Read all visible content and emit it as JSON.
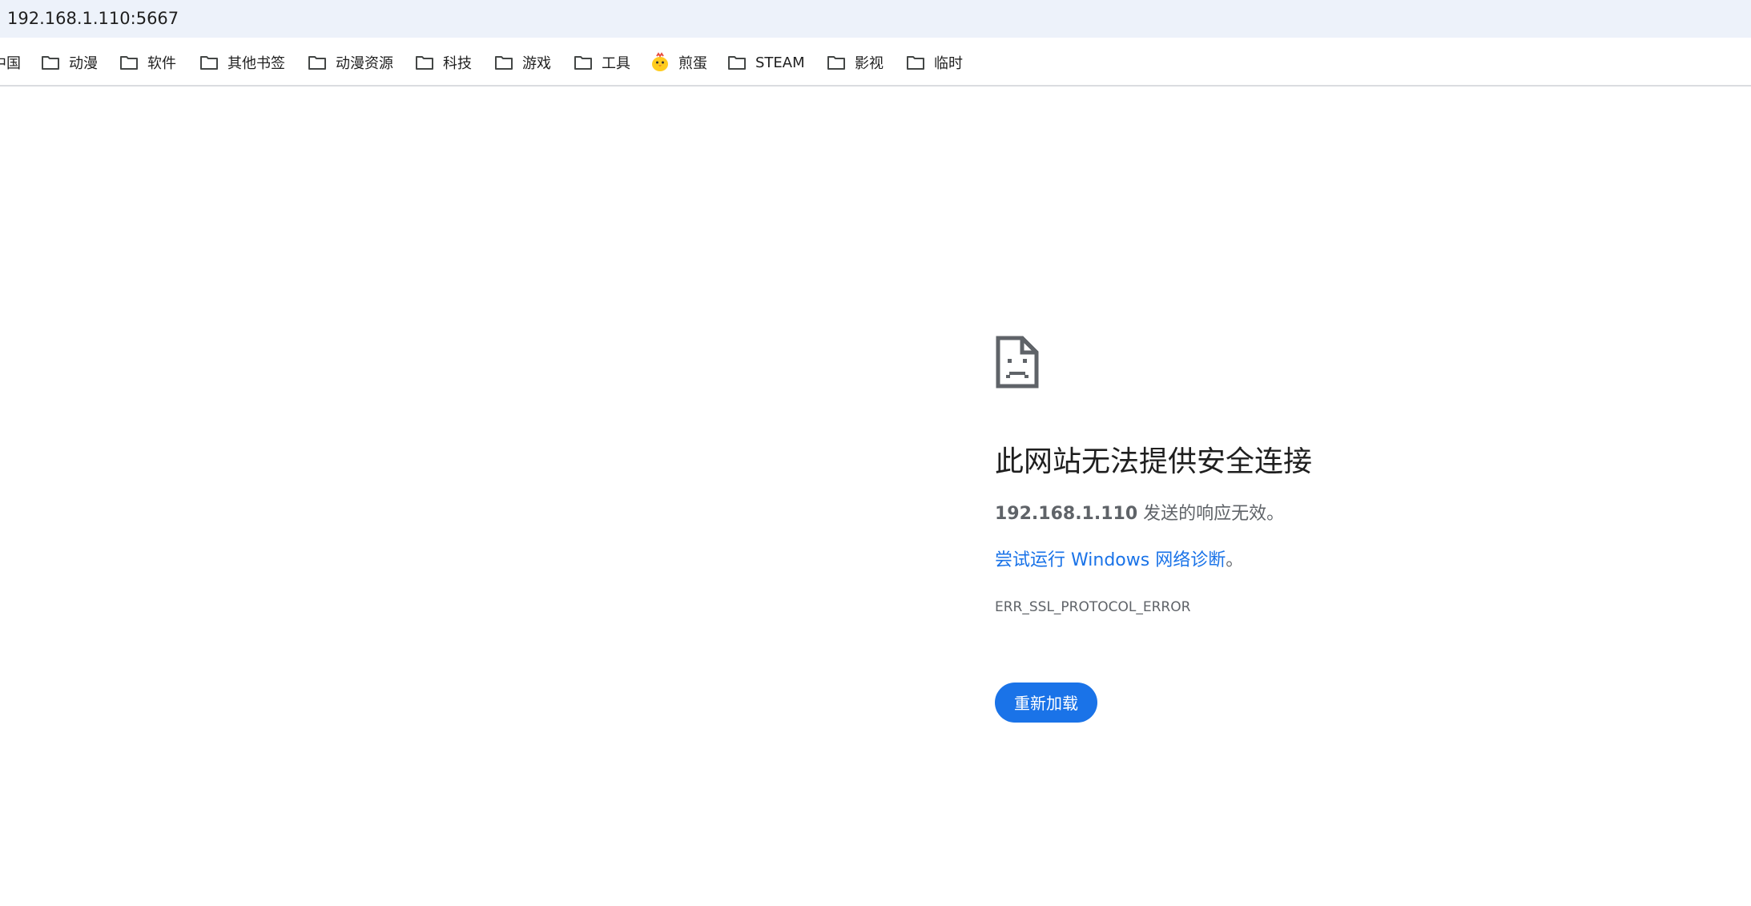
{
  "address_bar": {
    "url": "192.168.1.110:5667"
  },
  "bookmarks": {
    "partial_label": "中国",
    "items": [
      {
        "label": "动漫",
        "icon": "folder-icon"
      },
      {
        "label": "软件",
        "icon": "folder-icon"
      },
      {
        "label": "其他书签",
        "icon": "folder-icon"
      },
      {
        "label": "动漫资源",
        "icon": "folder-icon"
      },
      {
        "label": "科技",
        "icon": "folder-icon"
      },
      {
        "label": "游戏",
        "icon": "folder-icon"
      },
      {
        "label": "工具",
        "icon": "folder-icon"
      },
      {
        "label": "煎蛋",
        "icon": "chick-favicon"
      },
      {
        "label": "STEAM",
        "icon": "folder-icon"
      },
      {
        "label": "影视",
        "icon": "folder-icon"
      },
      {
        "label": "临时",
        "icon": "folder-icon"
      }
    ]
  },
  "error": {
    "icon": "sad-page-icon",
    "title": "此网站无法提供安全连接",
    "host": "192.168.1.110",
    "desc_suffix": " 发送的响应无效。",
    "diag_link": "尝试运行 Windows 网络诊断",
    "diag_suffix": "。",
    "code": "ERR_SSL_PROTOCOL_ERROR",
    "reload_label": "重新加载"
  },
  "colors": {
    "accent": "#1a73e8",
    "address_bar_bg": "#edf2fa",
    "text_primary": "#1f1f1f",
    "text_secondary": "#5f6368"
  }
}
